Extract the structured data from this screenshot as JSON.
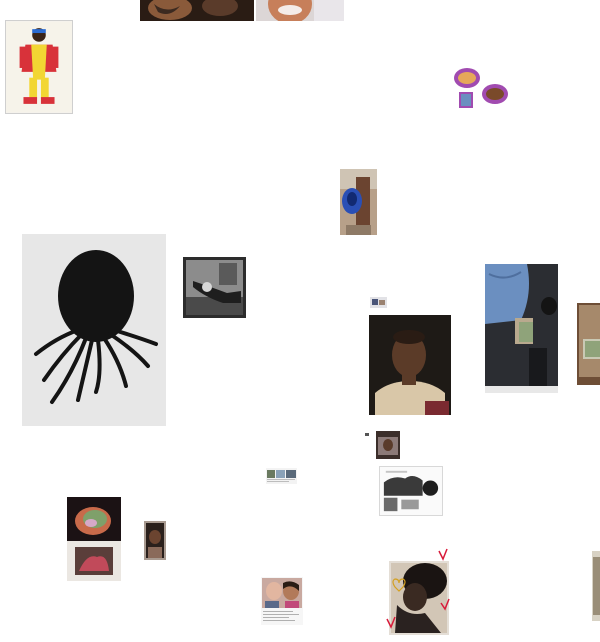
{
  "page": {
    "background": "#ffffff"
  },
  "colors": {
    "skin_dark": "#3a2418",
    "skin_mid": "#6b4430",
    "suit_red": "#d8323a",
    "suit_yellow": "#f2d633",
    "denim": "#6b8fc0",
    "bag_blue": "#2a4fb5",
    "portrait_bg": "#1e1a16",
    "portrait_coat": "#d9c7a8",
    "octopus_bg": "#e7e7e7",
    "octopus_body": "#141414"
  },
  "artworks": [
    {
      "id": "top-tattoo-crop",
      "icon": "tattoo-photo-icon"
    },
    {
      "id": "top-face-crop",
      "icon": "face-photo-icon"
    },
    {
      "id": "red-yellow-suit-figure",
      "icon": "figure-drawing-icon"
    },
    {
      "id": "purple-framed-collage",
      "icon": "collage-icon"
    },
    {
      "id": "blue-bag-street-photo",
      "icon": "street-photo-icon"
    },
    {
      "id": "braided-octopus-sculpture",
      "icon": "octopus-sculpture-icon"
    },
    {
      "id": "bw-hands-photo",
      "icon": "hands-photo-icon"
    },
    {
      "id": "tiny-thumb-upper",
      "icon": "thumbnail-icon"
    },
    {
      "id": "sepia-portrait",
      "icon": "portrait-icon"
    },
    {
      "id": "car-interior-cash",
      "icon": "car-photo-icon"
    },
    {
      "id": "right-edge-cash",
      "icon": "cash-photo-icon"
    },
    {
      "id": "small-photo-mid",
      "icon": "thumbnail-icon"
    },
    {
      "id": "tiny-dot",
      "icon": "thumbnail-icon"
    },
    {
      "id": "magazine-clipping",
      "icon": "clipping-icon"
    },
    {
      "id": "bw-collage-page",
      "icon": "collage-page-icon"
    },
    {
      "id": "stacked-colorful-prints",
      "icon": "print-stack-icon"
    },
    {
      "id": "small-dark-portrait",
      "icon": "portrait-icon"
    },
    {
      "id": "couple-clipping",
      "icon": "clipping-icon"
    },
    {
      "id": "heart-doodle-print",
      "icon": "heart-print-icon"
    },
    {
      "id": "right-edge-strip",
      "icon": "print-icon"
    }
  ]
}
